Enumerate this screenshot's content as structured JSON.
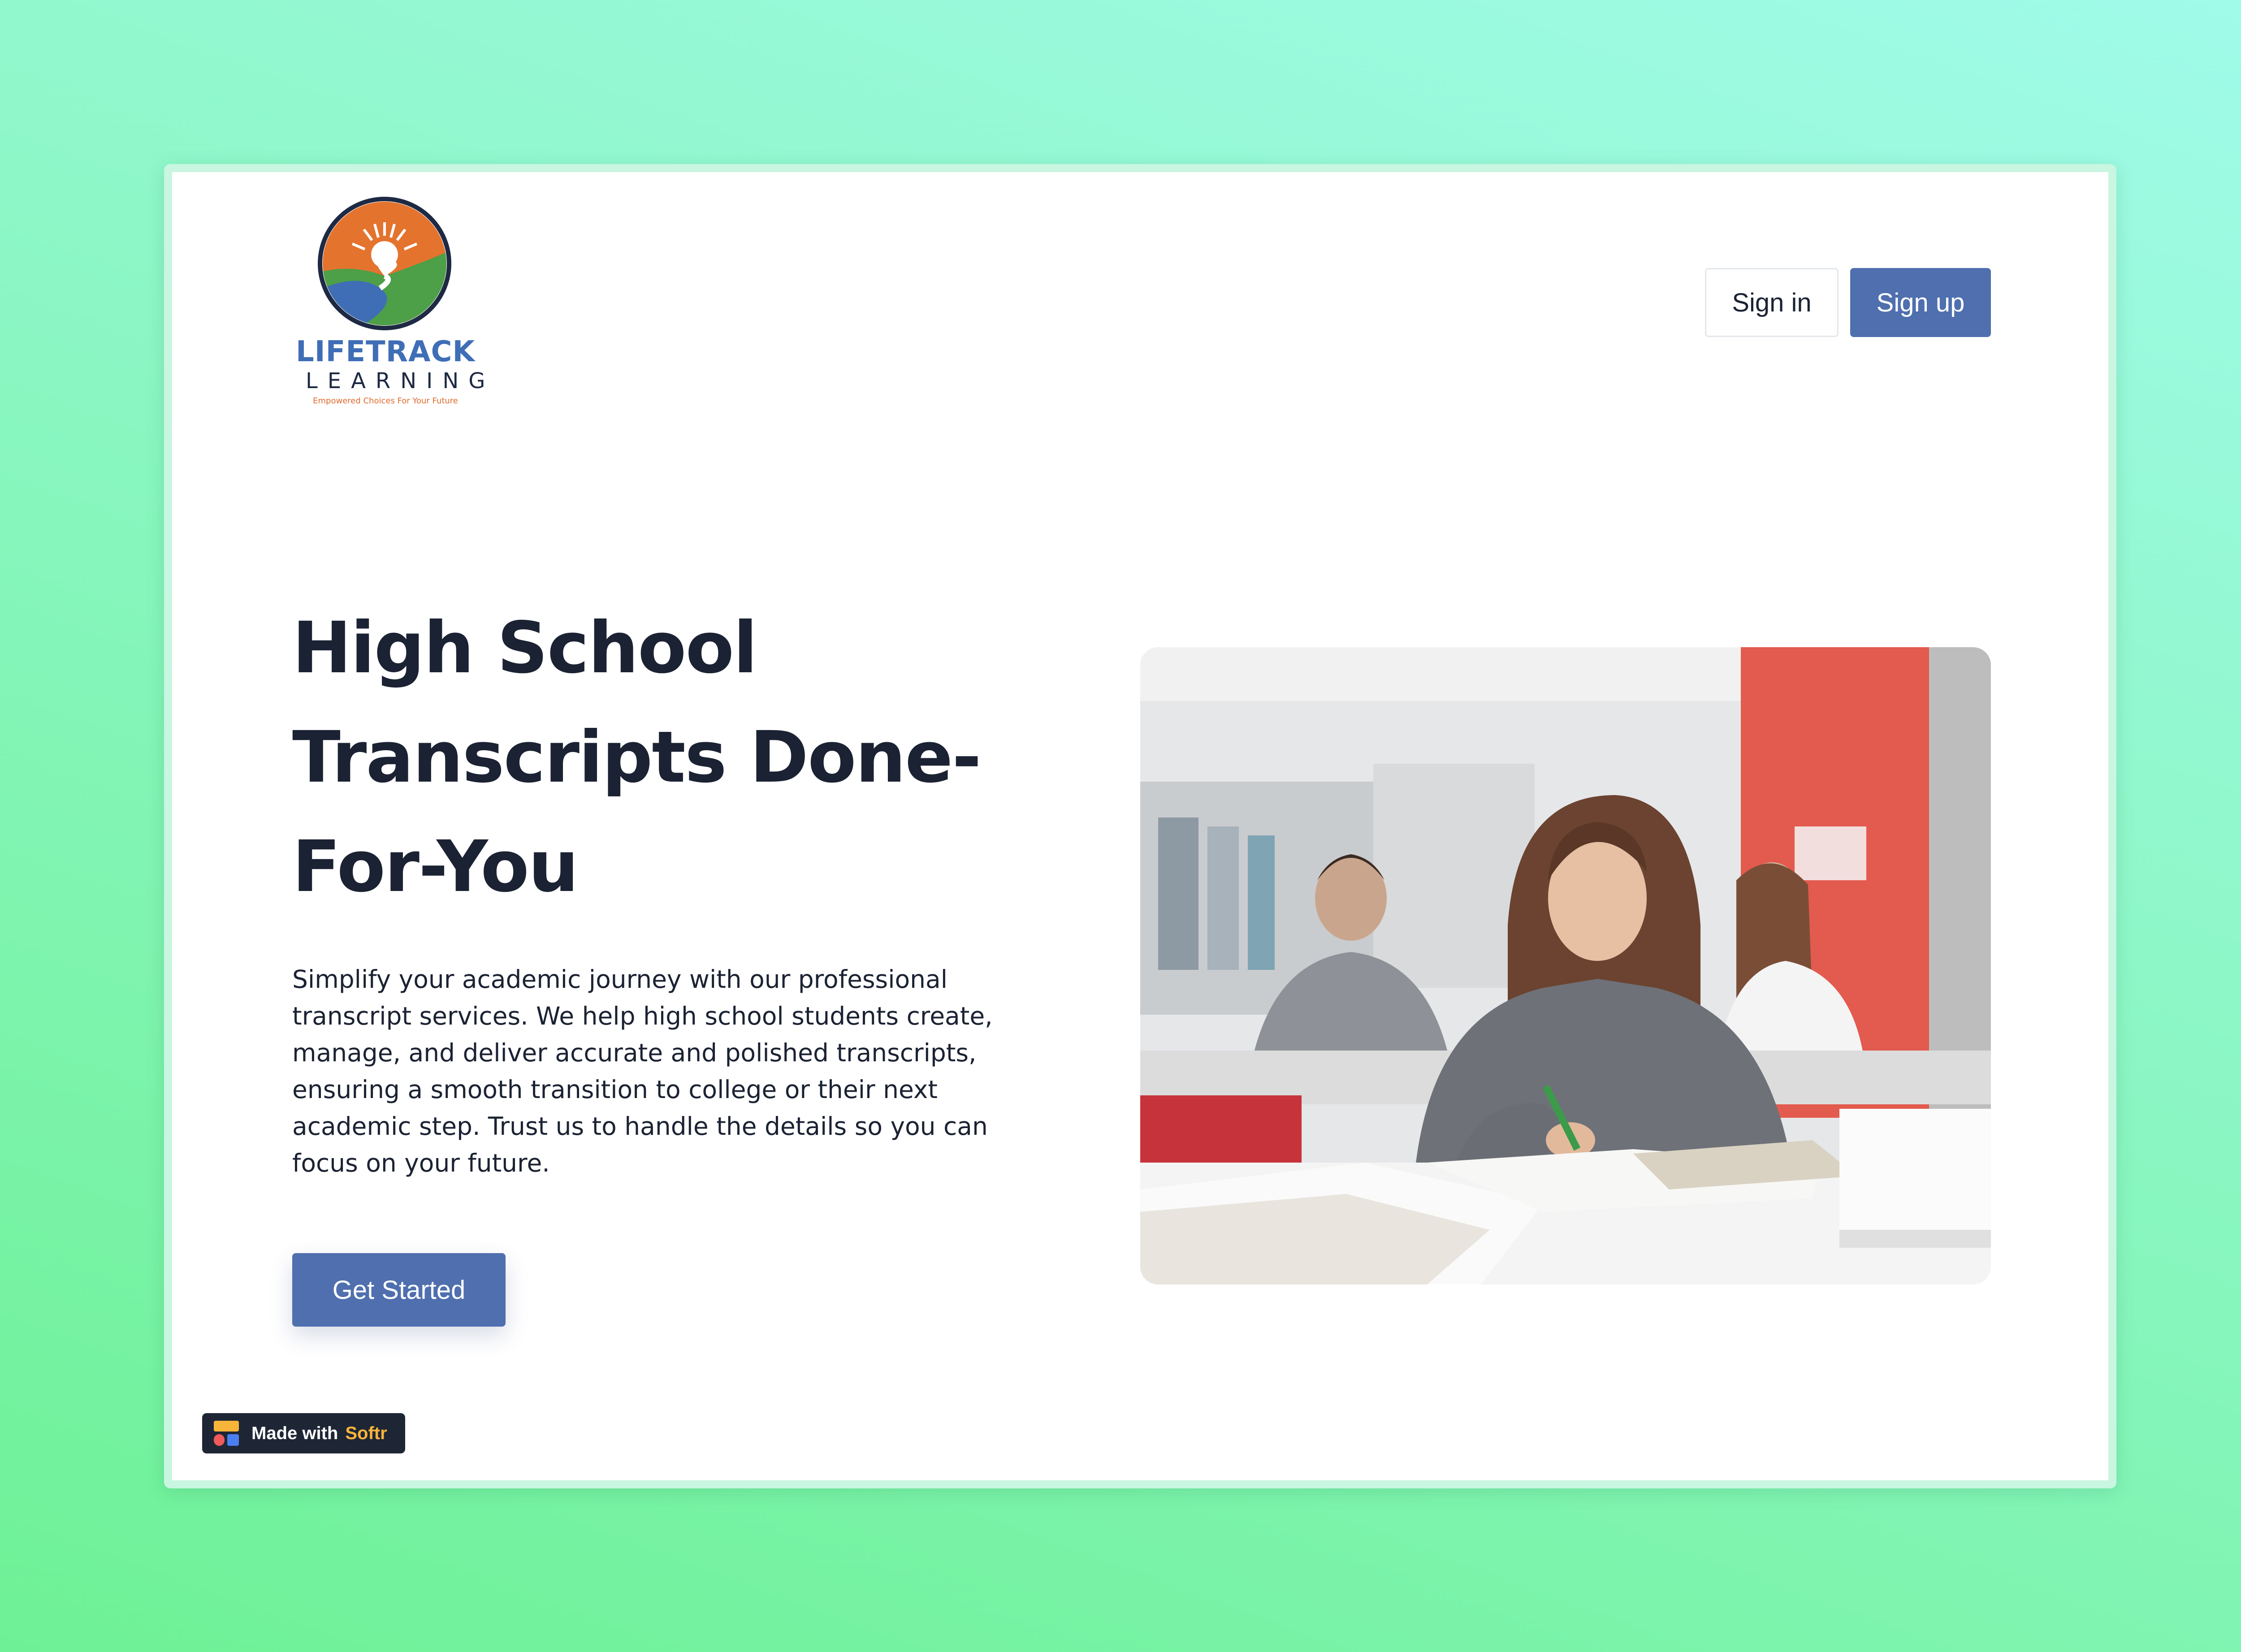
{
  "logo": {
    "name_line1": "LIFETRACK",
    "name_line2": "LEARNING",
    "tagline": "Empowered Choices For Your Future"
  },
  "header": {
    "signin_label": "Sign in",
    "signup_label": "Sign up"
  },
  "hero": {
    "title": "High School Transcripts Done-For-You",
    "description": "Simplify your academic journey with our professional transcript services. We help high school students create, manage, and deliver accurate and polished transcripts, ensuring a smooth transition to college or their next academic step. Trust us to handle the details so you can focus on your future.",
    "cta_label": "Get Started"
  },
  "badge": {
    "prefix": "Made with",
    "brand": "Softr"
  },
  "colors": {
    "primary": "#4f6faf",
    "text": "#1b2233",
    "background_top": "#a0fbe9",
    "background_bottom": "#6ef196",
    "badge_brand": "#f9b43a"
  }
}
